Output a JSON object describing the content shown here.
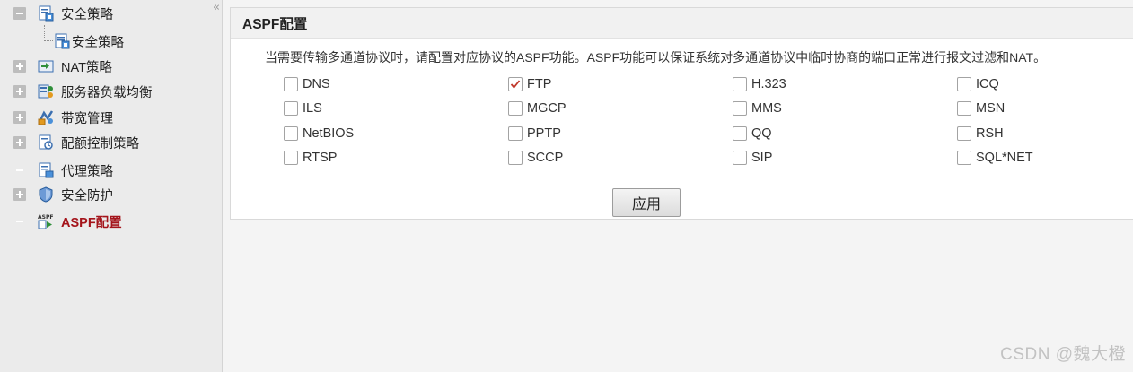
{
  "sidebar": {
    "items": [
      {
        "label": "安全策略",
        "expander": "minus",
        "icon": "security-policy-icon"
      },
      {
        "label": "安全策略",
        "expander": "none",
        "icon": "security-policy-icon"
      },
      {
        "label": "NAT策略",
        "expander": "plus",
        "icon": "nat-policy-icon"
      },
      {
        "label": "服务器负载均衡",
        "expander": "plus",
        "icon": "server-load-balance-icon"
      },
      {
        "label": "带宽管理",
        "expander": "plus",
        "icon": "bandwidth-management-icon"
      },
      {
        "label": "配额控制策略",
        "expander": "plus",
        "icon": "quota-control-icon"
      },
      {
        "label": "代理策略",
        "expander": "none",
        "icon": "proxy-policy-icon"
      },
      {
        "label": "安全防护",
        "expander": "plus",
        "icon": "shield-icon"
      },
      {
        "label": "ASPF配置",
        "expander": "none",
        "icon": "aspf-icon",
        "active": true
      }
    ],
    "collapse_glyph": "«"
  },
  "panel": {
    "title": "ASPF配置",
    "description": "当需要传输多通道协议时，请配置对应协议的ASPF功能。ASPF功能可以保证系统对多通道协议中临时协商的端口正常进行报文过滤和NAT。",
    "protocols": [
      {
        "label": "DNS",
        "checked": false
      },
      {
        "label": "FTP",
        "checked": true
      },
      {
        "label": "H.323",
        "checked": false
      },
      {
        "label": "ICQ",
        "checked": false
      },
      {
        "label": "ILS",
        "checked": false
      },
      {
        "label": "MGCP",
        "checked": false
      },
      {
        "label": "MMS",
        "checked": false
      },
      {
        "label": "MSN",
        "checked": false
      },
      {
        "label": "NetBIOS",
        "checked": false
      },
      {
        "label": "PPTP",
        "checked": false
      },
      {
        "label": "QQ",
        "checked": false
      },
      {
        "label": "RSH",
        "checked": false
      },
      {
        "label": "RTSP",
        "checked": false
      },
      {
        "label": "SCCP",
        "checked": false
      },
      {
        "label": "SIP",
        "checked": false
      },
      {
        "label": "SQL*NET",
        "checked": false
      }
    ],
    "apply_label": "应用"
  },
  "watermark": "CSDN @魏大橙",
  "colors": {
    "active_nav": "#a4141b",
    "check_mark": "#c0392b"
  }
}
